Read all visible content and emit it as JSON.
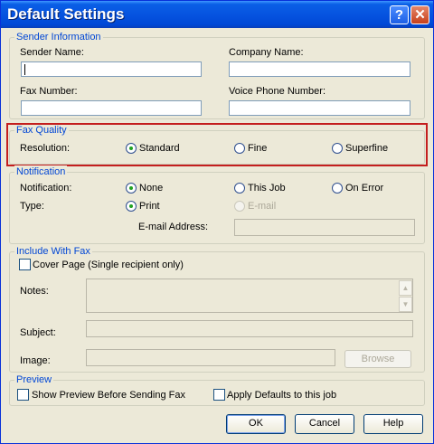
{
  "window": {
    "title": "Default Settings",
    "help_glyph": "?",
    "close_glyph": "✕"
  },
  "sender": {
    "legend": "Sender Information",
    "sender_name_label": "Sender Name:",
    "company_name_label": "Company Name:",
    "fax_number_label": "Fax Number:",
    "voice_phone_label": "Voice Phone Number:",
    "sender_name_value": "",
    "company_name_value": "",
    "fax_number_value": "",
    "voice_phone_value": ""
  },
  "fax_quality": {
    "legend": "Fax Quality",
    "resolution_label": "Resolution:",
    "options": [
      "Standard",
      "Fine",
      "Superfine"
    ],
    "selected": "Standard"
  },
  "notification": {
    "legend": "Notification",
    "notification_label": "Notification:",
    "notification_options": [
      "None",
      "This Job",
      "On Error"
    ],
    "notification_selected": "None",
    "type_label": "Type:",
    "type_options": [
      "Print",
      "E-mail"
    ],
    "type_selected": "Print",
    "email_address_label": "E-mail Address:",
    "email_address_value": ""
  },
  "include": {
    "legend": "Include With Fax",
    "cover_page_label": "Cover Page (Single recipient only)",
    "cover_page_checked": false,
    "notes_label": "Notes:",
    "subject_label": "Subject:",
    "image_label": "Image:",
    "browse_label": "Browse"
  },
  "preview": {
    "legend": "Preview",
    "show_preview_label": "Show Preview Before Sending Fax",
    "apply_defaults_label": "Apply Defaults to this job",
    "show_preview_checked": false,
    "apply_defaults_checked": false
  },
  "buttons": {
    "ok": "OK",
    "cancel": "Cancel",
    "help": "Help"
  },
  "colors": {
    "titlebar": "#0654e0",
    "legend_text": "#0046d5",
    "highlight_border": "#c41e1e",
    "dialog_bg": "#ece9d8"
  },
  "icons": {
    "help": "help-icon",
    "close": "close-icon",
    "scroll_up": "scroll-up-icon",
    "scroll_down": "scroll-down-icon"
  }
}
